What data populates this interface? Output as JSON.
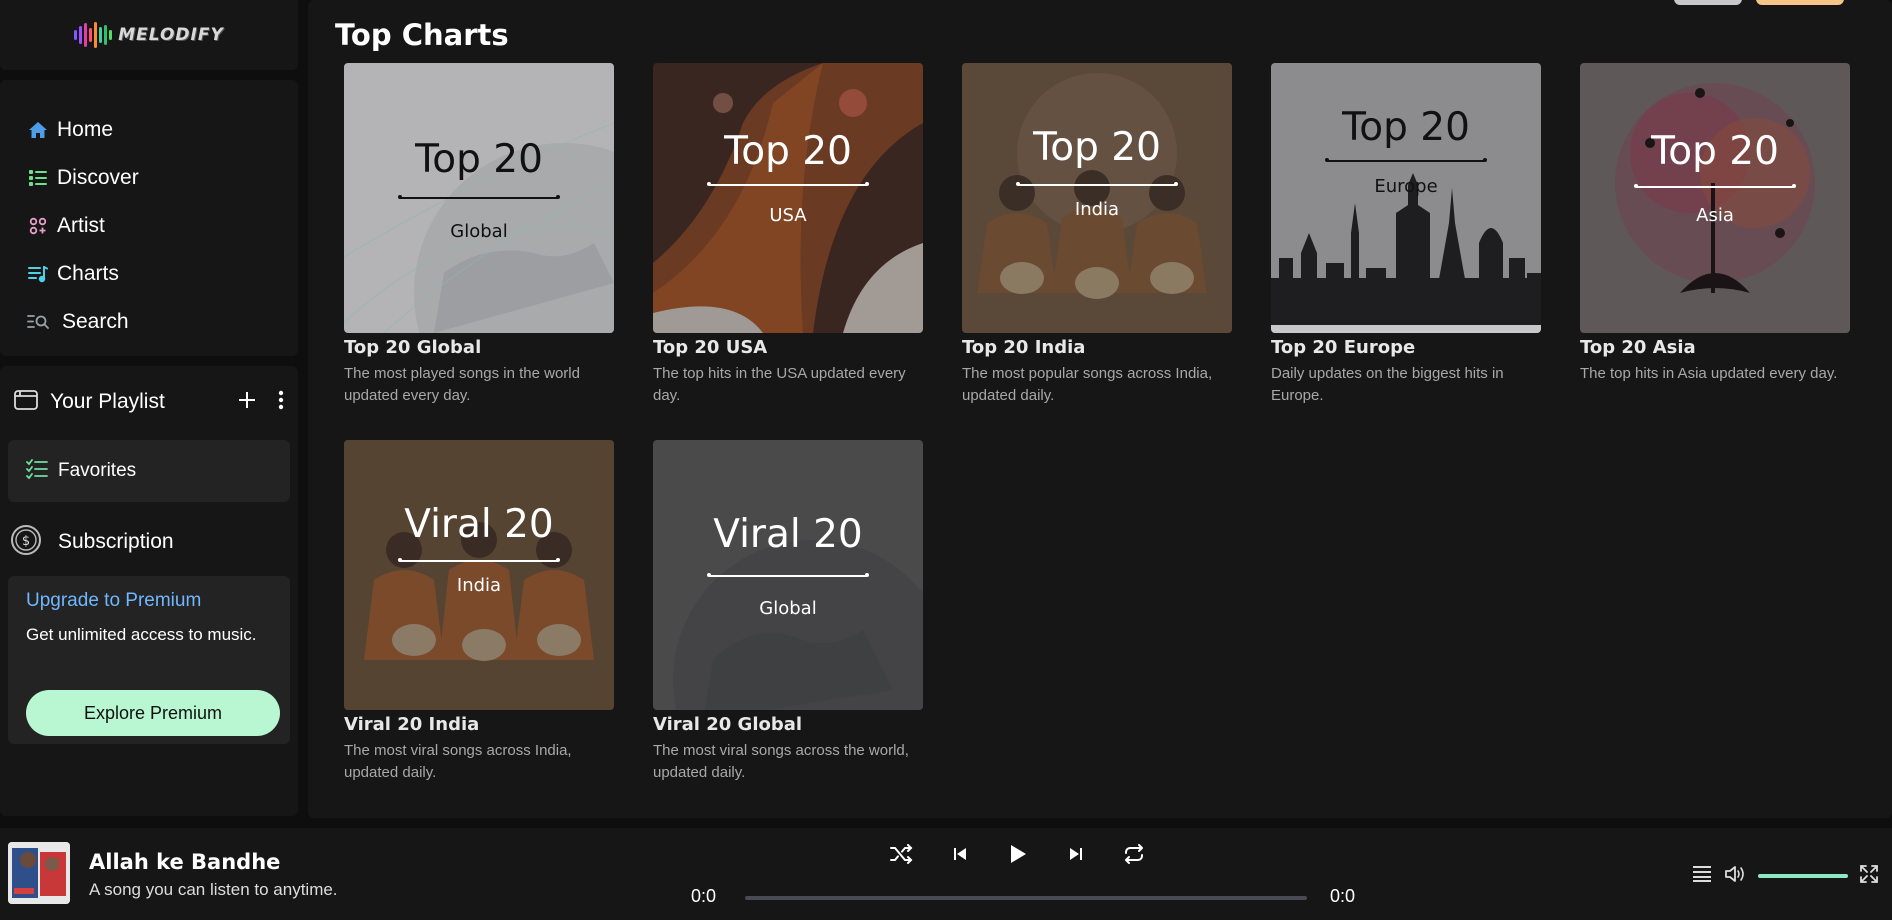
{
  "brand": {
    "name": "MELODIFY"
  },
  "nav": {
    "items": [
      {
        "label": "Home",
        "icon": "home-icon"
      },
      {
        "label": "Discover",
        "icon": "list-icon"
      },
      {
        "label": "Artist",
        "icon": "artist-icon"
      },
      {
        "label": "Charts",
        "icon": "charts-icon"
      },
      {
        "label": "Search",
        "icon": "search-icon"
      }
    ]
  },
  "playlist": {
    "header": "Your Playlist",
    "favorites": "Favorites",
    "subscription": "Subscription",
    "premium": {
      "title": "Upgrade to Premium",
      "description": "Get unlimited access to music.",
      "button": "Explore Premium"
    }
  },
  "main": {
    "title": "Top Charts",
    "cards": [
      {
        "cover_big": "Top 20",
        "cover_small": "Global",
        "title": "Top 20 Global",
        "desc": "The most played songs in the world updated every day."
      },
      {
        "cover_big": "Top 20",
        "cover_small": "USA",
        "title": "Top 20 USA",
        "desc": "The top hits in the USA updated every day."
      },
      {
        "cover_big": "Top 20",
        "cover_small": "India",
        "title": "Top 20 India",
        "desc": "The most popular songs across India, updated daily."
      },
      {
        "cover_big": "Top 20",
        "cover_small": "Europe",
        "title": "Top 20 Europe",
        "desc": "Daily updates on the biggest hits in Europe."
      },
      {
        "cover_big": "Top 20",
        "cover_small": "Asia",
        "title": "Top 20 Asia",
        "desc": "The top hits in Asia updated every day."
      },
      {
        "cover_big": "Viral 20",
        "cover_small": "India",
        "title": "Viral 20 India",
        "desc": "The most viral songs across India, updated daily."
      },
      {
        "cover_big": "Viral 20",
        "cover_small": "Global",
        "title": "Viral 20 Global",
        "desc": "The most viral songs across the world, updated daily."
      }
    ]
  },
  "player": {
    "song_title": "Allah ke Bandhe",
    "song_subtitle": "A song you can listen to anytime.",
    "time_current": "0:0",
    "time_total": "0:0",
    "progress": 0,
    "volume": 1.0
  },
  "colors": {
    "accent": "#b8f7d1",
    "premium_title": "#6fb7ff",
    "volume": "#8ee8c4"
  }
}
